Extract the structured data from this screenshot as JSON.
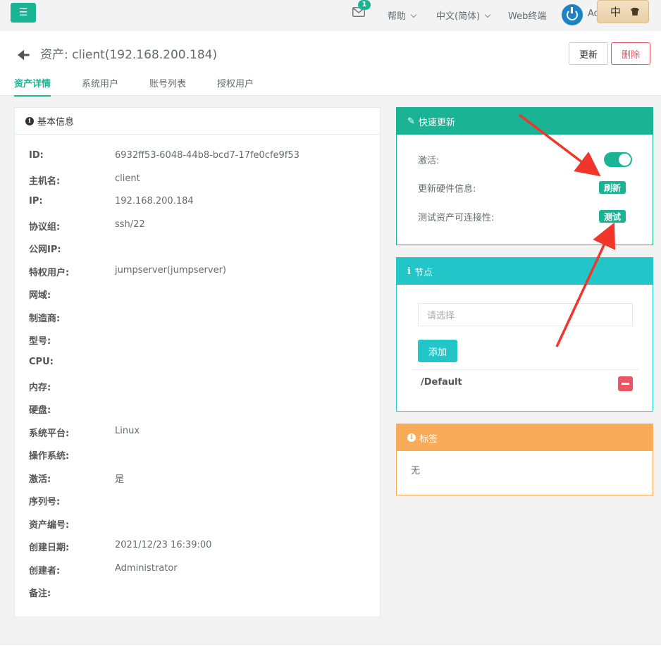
{
  "topbar": {
    "mail_badge": "1",
    "help_label": "帮助",
    "language_label": "中文(简体)",
    "web_terminal_label": "Web终端",
    "user_label": "Ad",
    "ime_label": "中"
  },
  "header": {
    "title": "资产: client(192.168.200.184)",
    "update_label": "更新",
    "delete_label": "删除",
    "tabs": [
      {
        "label": "资产详情",
        "active": true
      },
      {
        "label": "系统用户",
        "active": false
      },
      {
        "label": "账号列表",
        "active": false
      },
      {
        "label": "授权用户",
        "active": false
      }
    ]
  },
  "basic_info": {
    "title": "基本信息",
    "rows": [
      {
        "label": "ID:",
        "value": "6932ff53-6048-44b8-bcd7-17fe0cfe9f53"
      },
      {
        "label": "主机名:",
        "value": "client"
      },
      {
        "label": "IP:",
        "value": "192.168.200.184"
      },
      {
        "label": "协议组:",
        "value": "ssh/22"
      },
      {
        "label": "公网IP:",
        "value": ""
      },
      {
        "label": "特权用户:",
        "value": "jumpserver(jumpserver)"
      },
      {
        "label": "网域:",
        "value": ""
      },
      {
        "label": "制造商:",
        "value": ""
      },
      {
        "label": "型号:",
        "value": ""
      },
      {
        "label": "CPU:",
        "value": ""
      },
      {
        "label": "内存:",
        "value": ""
      },
      {
        "label": "硬盘:",
        "value": ""
      },
      {
        "label": "系统平台:",
        "value": "Linux"
      },
      {
        "label": "操作系统:",
        "value": ""
      },
      {
        "label": "激活:",
        "value": "是"
      },
      {
        "label": "序列号:",
        "value": ""
      },
      {
        "label": "资产编号:",
        "value": ""
      },
      {
        "label": "创建日期:",
        "value": "2021/12/23 16:39:00"
      },
      {
        "label": "创建者:",
        "value": "Administrator"
      },
      {
        "label": "备注:",
        "value": ""
      }
    ]
  },
  "quick_update": {
    "title": "快速更新",
    "active_label": "激活:",
    "active_on": true,
    "refresh_hw_label": "更新硬件信息:",
    "refresh_button": "刷新",
    "test_conn_label": "测试资产可连接性:",
    "test_button": "测试",
    "color": "#1ab394"
  },
  "nodes": {
    "title": "节点",
    "select_placeholder": "请选择",
    "add_button": "添加",
    "items": [
      "/Default"
    ],
    "color": "#23c6c8"
  },
  "tags": {
    "title": "标签",
    "empty_text": "无",
    "color": "#f8ac59"
  }
}
